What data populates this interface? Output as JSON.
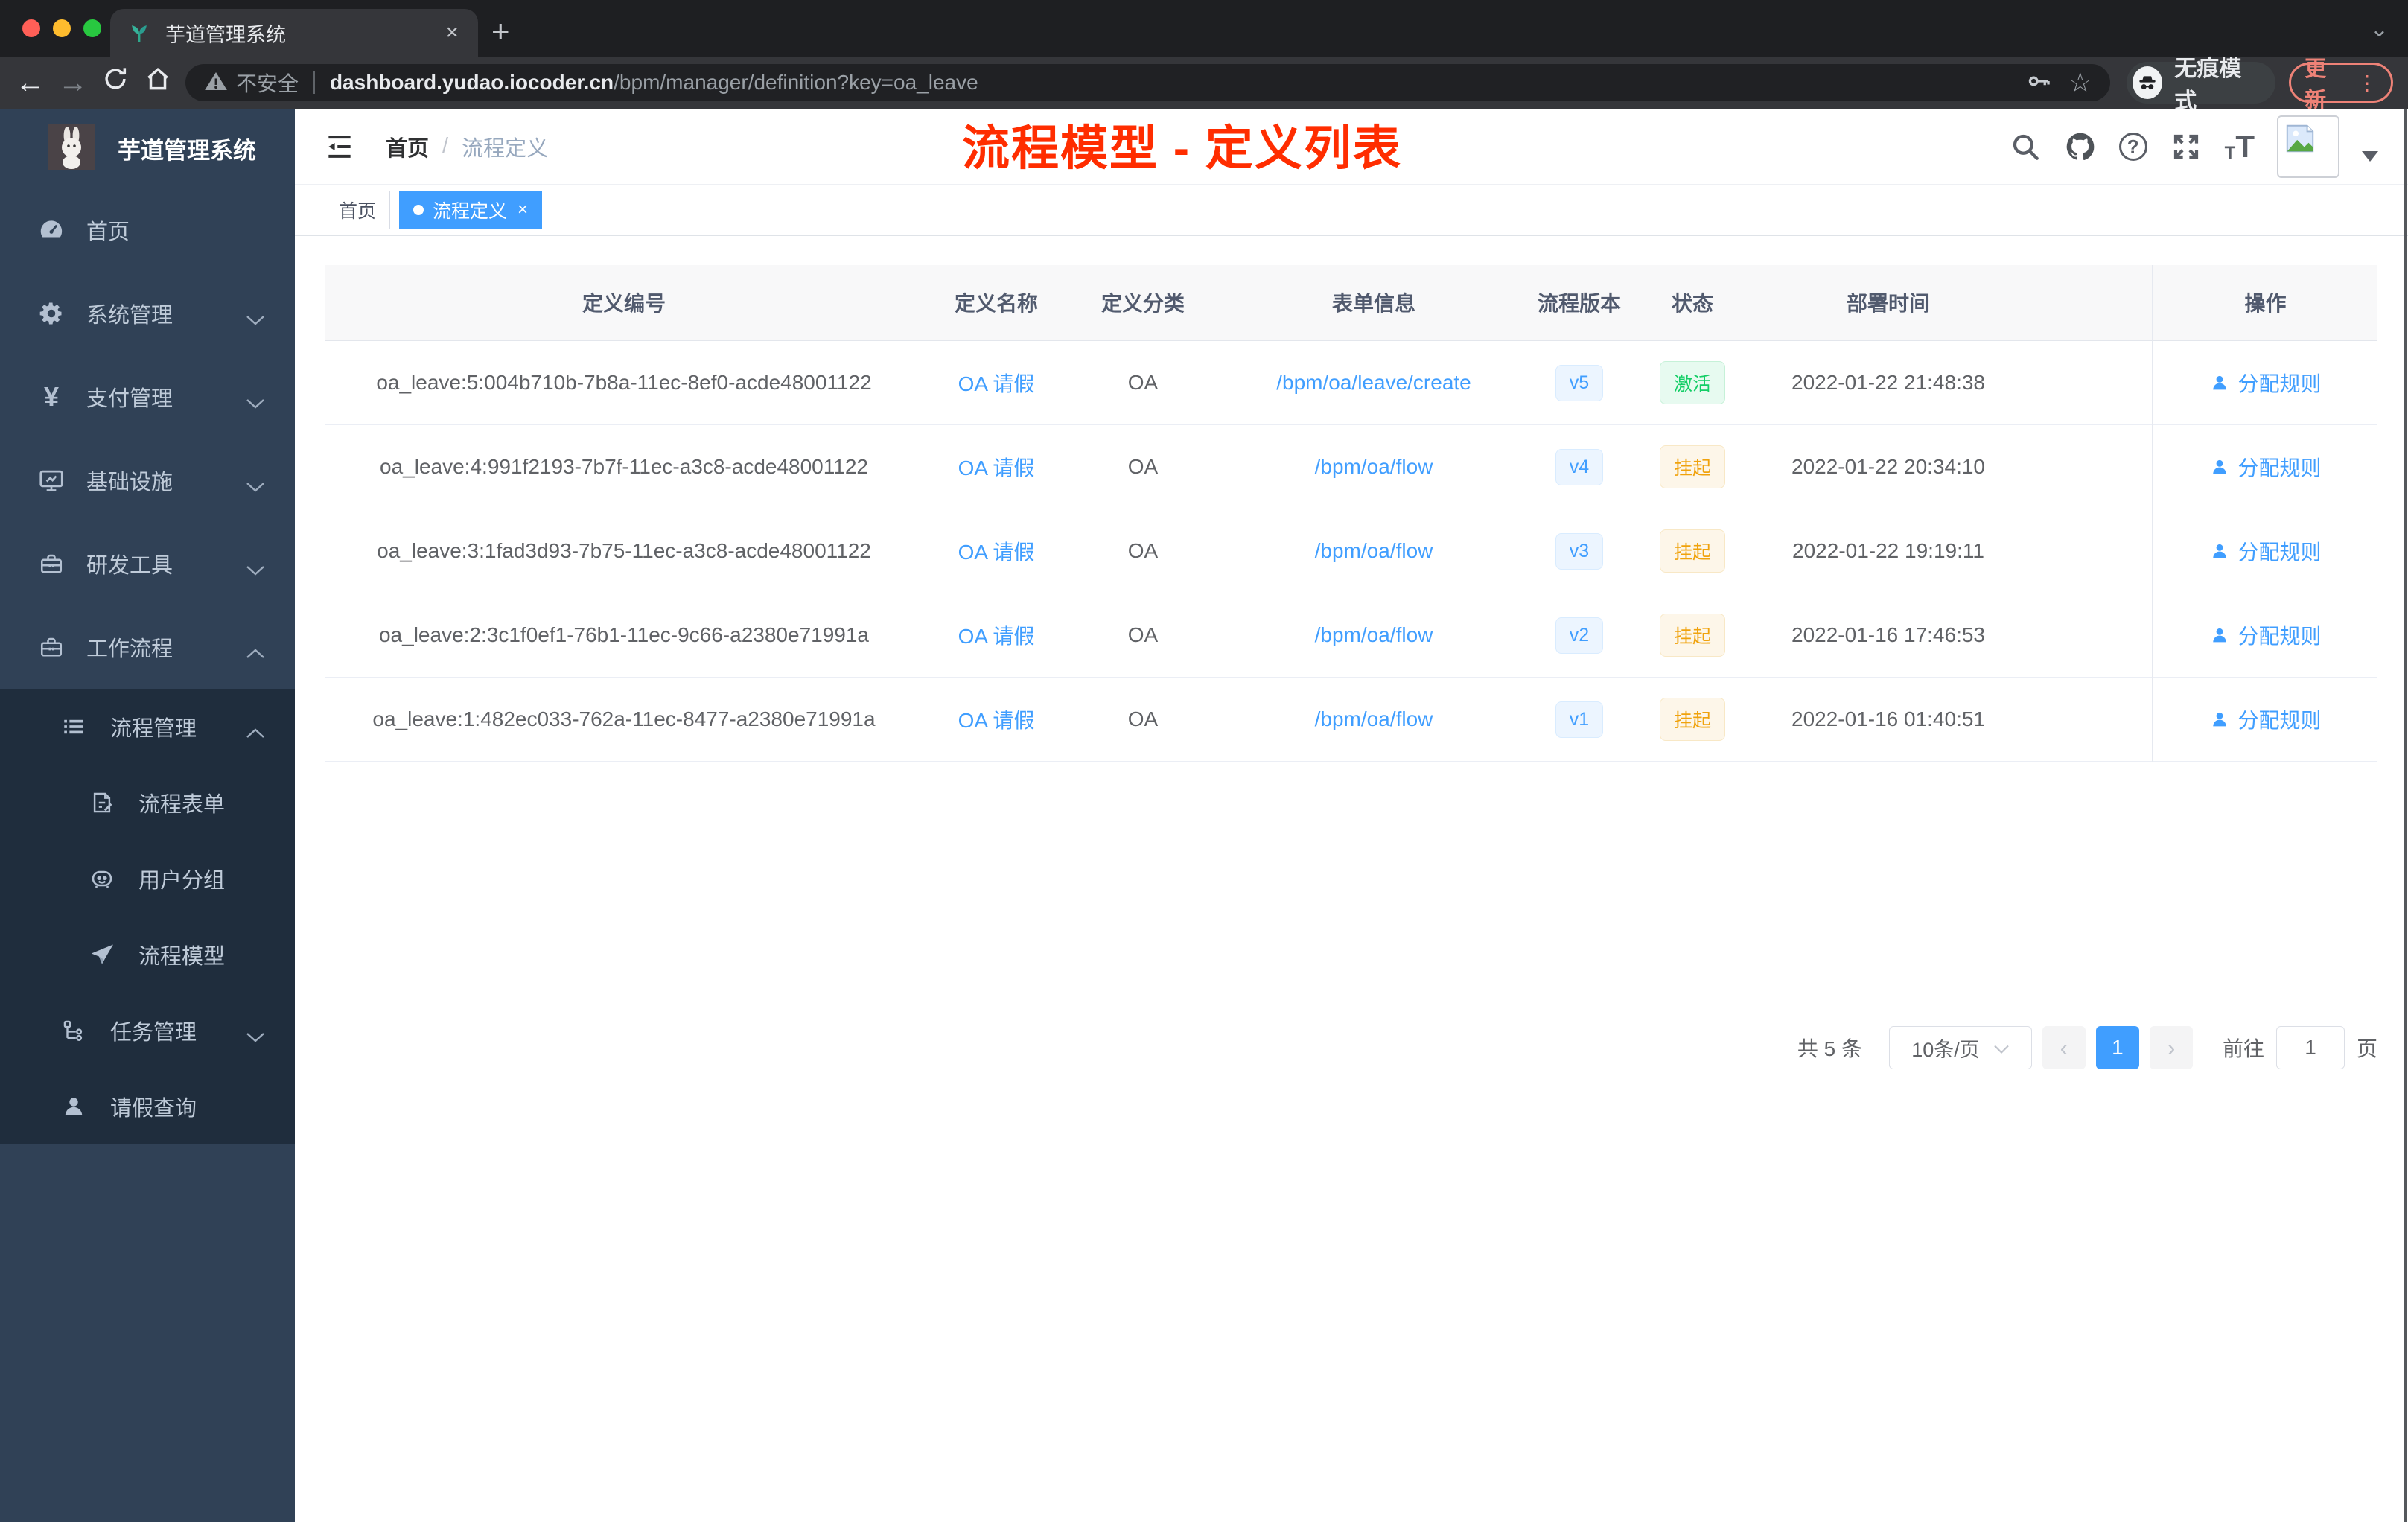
{
  "browser": {
    "tab": {
      "title": "芋道管理系统",
      "close": "×",
      "new_tab": "+",
      "chevron": "⌄"
    },
    "toolbar": {
      "back": "←",
      "forward": "→",
      "security_label": "不安全",
      "url_domain": "dashboard.yudao.iocoder.cn",
      "url_path": "/bpm/manager/definition?key=oa_leave",
      "star": "☆",
      "incognito_label": "无痕模式",
      "update_label": "更新",
      "menu_dots": "⋮"
    }
  },
  "sidebar": {
    "brand": "芋道管理系统",
    "items": [
      {
        "label": "首页"
      },
      {
        "label": "系统管理"
      },
      {
        "label": "支付管理"
      },
      {
        "label": "基础设施"
      },
      {
        "label": "研发工具"
      },
      {
        "label": "工作流程"
      }
    ],
    "submenu": [
      {
        "label": "流程管理"
      },
      {
        "label": "流程表单"
      },
      {
        "label": "用户分组"
      },
      {
        "label": "流程模型"
      },
      {
        "label": "任务管理"
      },
      {
        "label": "请假查询"
      }
    ]
  },
  "header": {
    "breadcrumb_home": "首页",
    "breadcrumb_sep": "/",
    "breadcrumb_current": "流程定义",
    "annotation": "流程模型 - 定义列表",
    "help_mark": "?",
    "font_small": "T",
    "font_big": "T"
  },
  "tags": {
    "home": "首页",
    "active": "流程定义",
    "close": "×"
  },
  "table": {
    "columns": [
      "定义编号",
      "定义名称",
      "定义分类",
      "表单信息",
      "流程版本",
      "状态",
      "部署时间",
      "操作"
    ],
    "rows": [
      {
        "id": "oa_leave:5:004b710b-7b8a-11ec-8ef0-acde48001122",
        "name": "OA 请假",
        "category": "OA",
        "form": "/bpm/oa/leave/create",
        "version": "v5",
        "status": "激活",
        "time": "2022-01-22 21:48:38",
        "action": "分配规则"
      },
      {
        "id": "oa_leave:4:991f2193-7b7f-11ec-a3c8-acde48001122",
        "name": "OA 请假",
        "category": "OA",
        "form": "/bpm/oa/flow",
        "version": "v4",
        "status": "挂起",
        "time": "2022-01-22 20:34:10",
        "action": "分配规则"
      },
      {
        "id": "oa_leave:3:1fad3d93-7b75-11ec-a3c8-acde48001122",
        "name": "OA 请假",
        "category": "OA",
        "form": "/bpm/oa/flow",
        "version": "v3",
        "status": "挂起",
        "time": "2022-01-22 19:19:11",
        "action": "分配规则"
      },
      {
        "id": "oa_leave:2:3c1f0ef1-76b1-11ec-9c66-a2380e71991a",
        "name": "OA 请假",
        "category": "OA",
        "form": "/bpm/oa/flow",
        "version": "v2",
        "status": "挂起",
        "time": "2022-01-16 17:46:53",
        "action": "分配规则"
      },
      {
        "id": "oa_leave:1:482ec033-762a-11ec-8477-a2380e71991a",
        "name": "OA 请假",
        "category": "OA",
        "form": "/bpm/oa/flow",
        "version": "v1",
        "status": "挂起",
        "time": "2022-01-16 01:40:51",
        "action": "分配规则"
      }
    ]
  },
  "pagination": {
    "total": "共 5 条",
    "page_size": "10条/页",
    "prev": "‹",
    "page": "1",
    "next": "›",
    "goto_label": "前往",
    "goto_value": "1",
    "unit": "页"
  },
  "colors": {
    "accent": "#409eff",
    "success": "#13ce66",
    "warning": "#f0a20c",
    "annotation_red": "#ff2d00",
    "sidebar_bg": "#304156",
    "submenu_bg": "#1f2d3d"
  }
}
